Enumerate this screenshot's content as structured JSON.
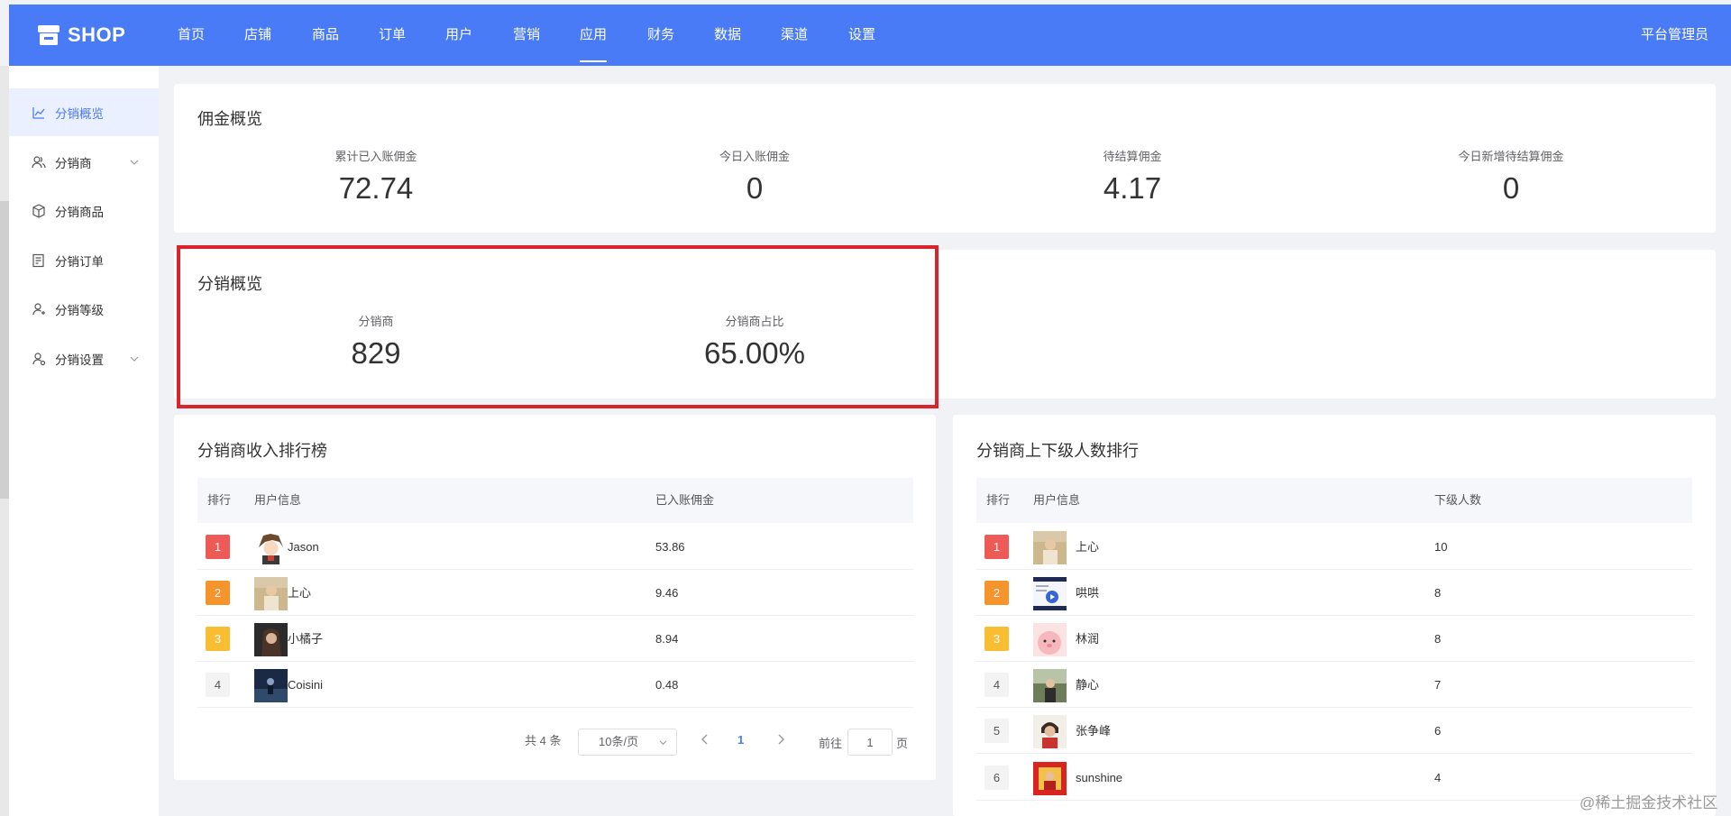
{
  "app": {
    "logo_text": "SHOP",
    "admin_label": "平台管理员"
  },
  "nav": {
    "items": [
      {
        "label": "首页"
      },
      {
        "label": "店铺"
      },
      {
        "label": "商品"
      },
      {
        "label": "订单"
      },
      {
        "label": "用户"
      },
      {
        "label": "营销"
      },
      {
        "label": "应用"
      },
      {
        "label": "财务"
      },
      {
        "label": "数据"
      },
      {
        "label": "渠道"
      },
      {
        "label": "设置"
      }
    ],
    "active": "应用"
  },
  "sidebar": {
    "items": [
      {
        "label": "分销概览",
        "icon": "chart-line-icon",
        "active": true
      },
      {
        "label": "分销商",
        "icon": "users-icon",
        "has_submenu": true
      },
      {
        "label": "分销商品",
        "icon": "box-icon"
      },
      {
        "label": "分销订单",
        "icon": "order-icon"
      },
      {
        "label": "分销等级",
        "icon": "user-level-icon"
      },
      {
        "label": "分销设置",
        "icon": "user-settings-icon",
        "has_submenu": true
      }
    ]
  },
  "commission": {
    "title": "佣金概览",
    "stats": [
      {
        "label": "累计已入账佣金",
        "value": "72.74"
      },
      {
        "label": "今日入账佣金",
        "value": "0"
      },
      {
        "label": "待结算佣金",
        "value": "4.17"
      },
      {
        "label": "今日新增待结算佣金",
        "value": "0"
      }
    ]
  },
  "distribution": {
    "title": "分销概览",
    "stats": [
      {
        "label": "分销商",
        "value": "829"
      },
      {
        "label": "分销商占比",
        "value": "65.00%"
      }
    ]
  },
  "income_rank": {
    "title": "分销商收入排行榜",
    "columns": [
      "排行",
      "用户信息",
      "已入账佣金"
    ],
    "rows": [
      {
        "rank": "1",
        "name": "Jason",
        "value": "53.86"
      },
      {
        "rank": "2",
        "name": "上心",
        "value": "9.46"
      },
      {
        "rank": "3",
        "name": "小橘子",
        "value": "8.94"
      },
      {
        "rank": "4",
        "name": "Coisini",
        "value": "0.48"
      }
    ],
    "pagination": {
      "total": "共 4 条",
      "page_size": "10条/页",
      "current_page": "1",
      "goto_label": "前往",
      "goto_value": "1",
      "page_suffix": "页"
    }
  },
  "member_rank": {
    "title": "分销商上下级人数排行",
    "columns": [
      "排行",
      "用户信息",
      "下级人数"
    ],
    "rows": [
      {
        "rank": "1",
        "name": "上心",
        "value": "10"
      },
      {
        "rank": "2",
        "name": "哄哄",
        "value": "8"
      },
      {
        "rank": "3",
        "name": "林润",
        "value": "8"
      },
      {
        "rank": "4",
        "name": "静心",
        "value": "7"
      },
      {
        "rank": "5",
        "name": "张争峰",
        "value": "6"
      },
      {
        "rank": "6",
        "name": "sunshine",
        "value": "4"
      }
    ]
  },
  "watermark": "@稀土掘金技术社区",
  "colors": {
    "primary": "#4a7bf7",
    "rank1": "#ee5b57",
    "rank2": "#f5942a",
    "rank3": "#f9bd32",
    "highlight_box": "#d9242c"
  }
}
